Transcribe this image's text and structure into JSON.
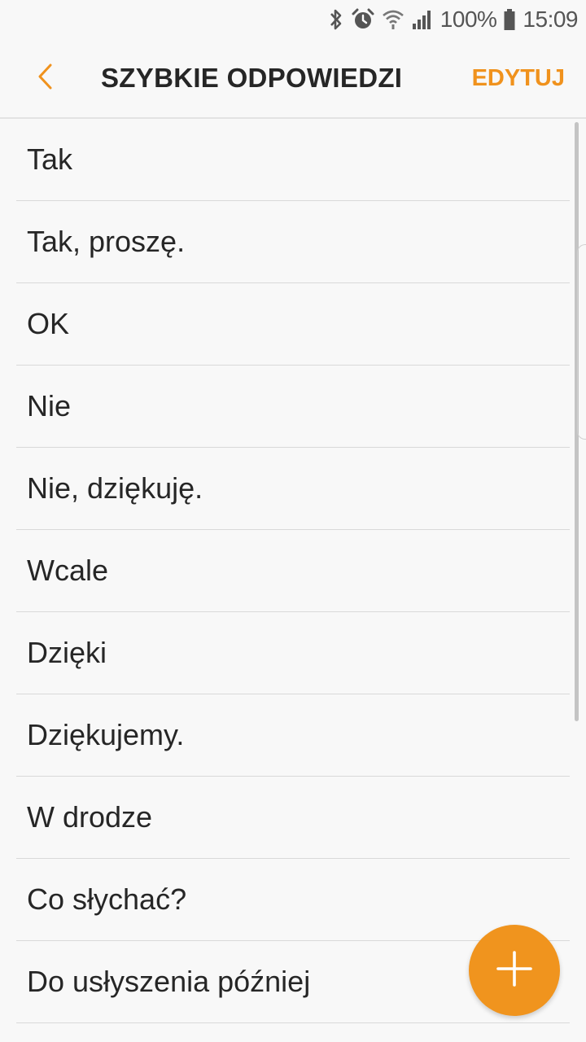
{
  "status_bar": {
    "battery": "100%",
    "time": "15:09",
    "icons": [
      "bluetooth-icon",
      "alarm-icon",
      "wifi-icon",
      "signal-icon",
      "battery-icon"
    ]
  },
  "header": {
    "title": "SZYBKIE ODPOWIEDZI",
    "edit_label": "EDYTUJ",
    "back_icon": "chevron-left-icon"
  },
  "replies": [
    "Tak",
    "Tak, proszę.",
    "OK",
    "Nie",
    "Nie, dziękuję.",
    "Wcale",
    "Dzięki",
    "Dziękujemy.",
    "W drodze",
    "Co słychać?",
    "Do usłyszenia później"
  ],
  "fab": {
    "icon": "plus-icon"
  },
  "colors": {
    "accent": "#f0921d",
    "background": "#f8f8f8",
    "text": "#262626",
    "divider": "#d9d9d9"
  }
}
